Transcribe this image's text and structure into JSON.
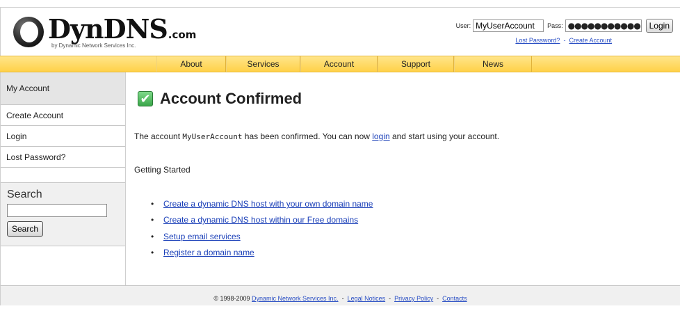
{
  "header": {
    "logo_text": "DynDNS",
    "logo_suffix": ".com",
    "logo_tagline": "by Dynamic Network Services Inc.",
    "user_label": "User:",
    "user_value": "MyUserAccount",
    "pass_label": "Pass:",
    "pass_value": "●●●●●●●●●●●",
    "login_button": "Login",
    "lost_password_link": "Lost Password?",
    "link_separator": "-",
    "create_account_link": "Create Account"
  },
  "nav": {
    "items": [
      {
        "label": "About"
      },
      {
        "label": "Services"
      },
      {
        "label": "Account"
      },
      {
        "label": "Support"
      },
      {
        "label": "News"
      }
    ]
  },
  "sidebar": {
    "header": "My Account",
    "items": [
      {
        "label": "Create Account"
      },
      {
        "label": "Login"
      },
      {
        "label": "Lost Password?"
      }
    ],
    "search": {
      "title": "Search",
      "input_value": "",
      "button": "Search"
    }
  },
  "main": {
    "title": "Account Confirmed",
    "confirm_prefix": "The account ",
    "account_name": "MyUserAccount",
    "confirm_middle": " has been confirmed. You can now ",
    "login_link": "login",
    "confirm_suffix": " and start using your account.",
    "getting_started": "Getting Started",
    "links": [
      {
        "label": "Create a dynamic DNS host with your own domain name"
      },
      {
        "label": "Create a dynamic DNS host within our Free domains"
      },
      {
        "label": "Setup email services"
      },
      {
        "label": "Register a domain name"
      }
    ]
  },
  "footer": {
    "copyright": "© 1998-2009",
    "company_link": "Dynamic Network Services Inc.",
    "separator": "-",
    "legal_link": "Legal Notices",
    "privacy_link": "Privacy Policy",
    "contacts_link": "Contacts"
  },
  "colors": {
    "nav_bar": "#ffd148",
    "link": "#1a3fb8",
    "check_icon": "#3aa64a",
    "sidebar_header": "#e5e5e5"
  },
  "icons": {
    "logo_mark": "dyndns-logo-icon",
    "title_check": "checkbox-checked-icon"
  }
}
